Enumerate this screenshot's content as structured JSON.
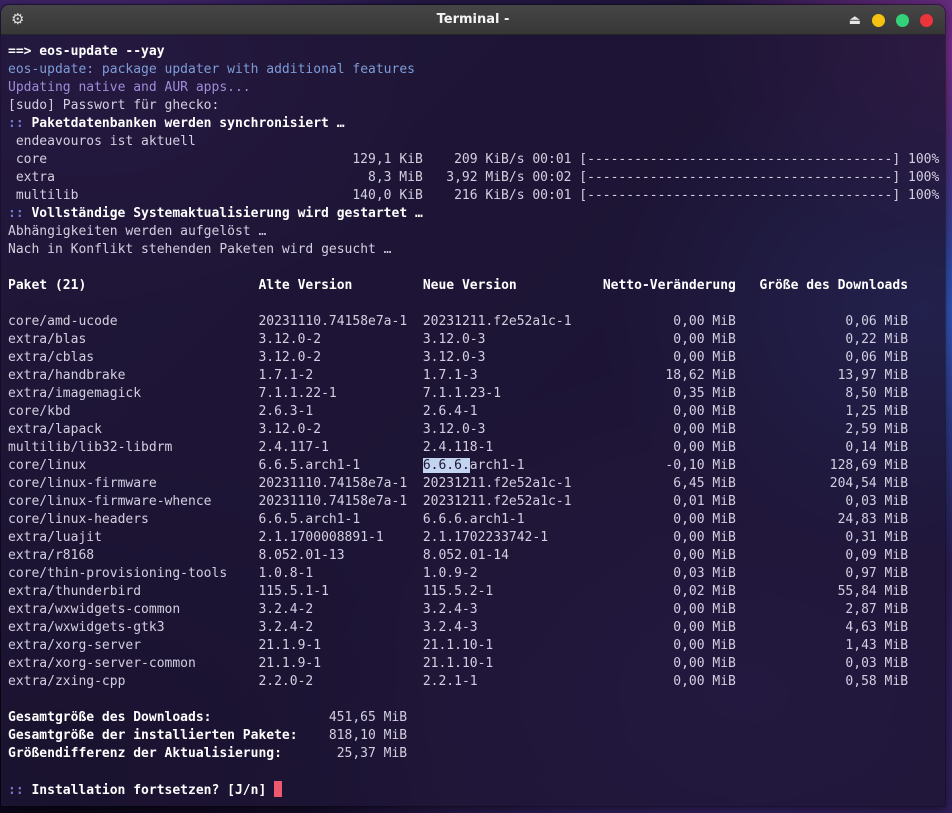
{
  "window": {
    "title": "Terminal -"
  },
  "icons": {
    "app_gear": "⚙",
    "shade": "⏏"
  },
  "colors": {
    "terminal_bg": "#1e1534",
    "default_text": "#d3cfe1",
    "bold_text": "#ffffff",
    "info_blue": "#7e9cd8",
    "info_purple": "#9e8cd8",
    "marker_blue": "#7678d4",
    "cursor_pink": "#ef5970",
    "highlight_bg": "#c3d4f0",
    "titlebar_bg": "#3b3b3b",
    "btn_yellow": "#f5c211",
    "btn_green": "#33d17a",
    "btn_red": "#ed333b"
  },
  "terminal": {
    "cmd_line": "==> eos-update --yay",
    "eos_info": "eos-update: package updater with additional features",
    "updating_line": "Updating native and AUR apps...",
    "sudo_line": "[sudo] Passwort für ghecko:",
    "marker": "::",
    "sync_msg": "Paketdatenbanken werden synchronisiert …",
    "uptodate_line": " endeavouros ist aktuell",
    "downloads": [
      {
        "name": " core",
        "size": "129,1 KiB",
        "speed": "209 KiB/s",
        "time": "00:01",
        "bar": "[---------------------------------------]",
        "pct": "100%"
      },
      {
        "name": " extra",
        "size": "8,3 MiB",
        "speed": "3,92 MiB/s",
        "time": "00:02",
        "bar": "[---------------------------------------]",
        "pct": "100%"
      },
      {
        "name": " multilib",
        "size": "140,0 KiB",
        "speed": "216 KiB/s",
        "time": "00:01",
        "bar": "[---------------------------------------]",
        "pct": "100%"
      }
    ],
    "upgrade_msg": "Vollständige Systemaktualisierung wird gestartet …",
    "resolve_line": "Abhängigkeiten werden aufgelöst …",
    "conflict_line": "Nach in Konflikt stehenden Paketen wird gesucht …",
    "table": {
      "headers": {
        "paket": "Paket (21)",
        "alt": "Alte Version",
        "neu": "Neue Version",
        "netto": "Netto-Veränderung",
        "groesse": "Größe des Downloads"
      },
      "rows": [
        {
          "paket": "core/amd-ucode",
          "alt": "20231110.74158e7a-1",
          "neu_hl": "",
          "neu": "20231211.f2e52a1c-1",
          "netto": "0,00 MiB",
          "groesse": "0,06 MiB"
        },
        {
          "paket": "extra/blas",
          "alt": "3.12.0-2",
          "neu_hl": "",
          "neu": "3.12.0-3",
          "netto": "0,00 MiB",
          "groesse": "0,22 MiB"
        },
        {
          "paket": "extra/cblas",
          "alt": "3.12.0-2",
          "neu_hl": "",
          "neu": "3.12.0-3",
          "netto": "0,00 MiB",
          "groesse": "0,06 MiB"
        },
        {
          "paket": "extra/handbrake",
          "alt": "1.7.1-2",
          "neu_hl": "",
          "neu": "1.7.1-3",
          "netto": "18,62 MiB",
          "groesse": "13,97 MiB"
        },
        {
          "paket": "extra/imagemagick",
          "alt": "7.1.1.22-1",
          "neu_hl": "",
          "neu": "7.1.1.23-1",
          "netto": "0,35 MiB",
          "groesse": "8,50 MiB"
        },
        {
          "paket": "core/kbd",
          "alt": "2.6.3-1",
          "neu_hl": "",
          "neu": "2.6.4-1",
          "netto": "0,00 MiB",
          "groesse": "1,25 MiB"
        },
        {
          "paket": "extra/lapack",
          "alt": "3.12.0-2",
          "neu_hl": "",
          "neu": "3.12.0-3",
          "netto": "0,00 MiB",
          "groesse": "2,59 MiB"
        },
        {
          "paket": "multilib/lib32-libdrm",
          "alt": "2.4.117-1",
          "neu_hl": "",
          "neu": "2.4.118-1",
          "netto": "0,00 MiB",
          "groesse": "0,14 MiB"
        },
        {
          "paket": "core/linux",
          "alt": "6.6.5.arch1-1",
          "neu_hl": "6.6.6.",
          "neu": "arch1-1",
          "netto": "-0,10 MiB",
          "groesse": "128,69 MiB"
        },
        {
          "paket": "core/linux-firmware",
          "alt": "20231110.74158e7a-1",
          "neu_hl": "",
          "neu": "20231211.f2e52a1c-1",
          "netto": "6,45 MiB",
          "groesse": "204,54 MiB"
        },
        {
          "paket": "core/linux-firmware-whence",
          "alt": "20231110.74158e7a-1",
          "neu_hl": "",
          "neu": "20231211.f2e52a1c-1",
          "netto": "0,01 MiB",
          "groesse": "0,03 MiB"
        },
        {
          "paket": "core/linux-headers",
          "alt": "6.6.5.arch1-1",
          "neu_hl": "",
          "neu": "6.6.6.arch1-1",
          "netto": "0,00 MiB",
          "groesse": "24,83 MiB"
        },
        {
          "paket": "extra/luajit",
          "alt": "2.1.1700008891-1",
          "neu_hl": "",
          "neu": "2.1.1702233742-1",
          "netto": "0,00 MiB",
          "groesse": "0,31 MiB"
        },
        {
          "paket": "extra/r8168",
          "alt": "8.052.01-13",
          "neu_hl": "",
          "neu": "8.052.01-14",
          "netto": "0,00 MiB",
          "groesse": "0,09 MiB"
        },
        {
          "paket": "core/thin-provisioning-tools",
          "alt": "1.0.8-1",
          "neu_hl": "",
          "neu": "1.0.9-2",
          "netto": "0,03 MiB",
          "groesse": "0,97 MiB"
        },
        {
          "paket": "extra/thunderbird",
          "alt": "115.5.1-1",
          "neu_hl": "",
          "neu": "115.5.2-1",
          "netto": "0,02 MiB",
          "groesse": "55,84 MiB"
        },
        {
          "paket": "extra/wxwidgets-common",
          "alt": "3.2.4-2",
          "neu_hl": "",
          "neu": "3.2.4-3",
          "netto": "0,00 MiB",
          "groesse": "2,87 MiB"
        },
        {
          "paket": "extra/wxwidgets-gtk3",
          "alt": "3.2.4-2",
          "neu_hl": "",
          "neu": "3.2.4-3",
          "netto": "0,00 MiB",
          "groesse": "4,63 MiB"
        },
        {
          "paket": "extra/xorg-server",
          "alt": "21.1.9-1",
          "neu_hl": "",
          "neu": "21.1.10-1",
          "netto": "0,00 MiB",
          "groesse": "1,43 MiB"
        },
        {
          "paket": "extra/xorg-server-common",
          "alt": "21.1.9-1",
          "neu_hl": "",
          "neu": "21.1.10-1",
          "netto": "0,00 MiB",
          "groesse": "0,03 MiB"
        },
        {
          "paket": "extra/zxing-cpp",
          "alt": "2.2.0-2",
          "neu_hl": "",
          "neu": "2.2.1-1",
          "netto": "0,00 MiB",
          "groesse": "0,58 MiB"
        }
      ]
    },
    "summary": [
      {
        "label": "Gesamtgröße des Downloads:",
        "value": "451,65 MiB"
      },
      {
        "label": "Gesamtgröße der installierten Pakete:",
        "value": "818,10 MiB"
      },
      {
        "label": "Größendifferenz der Aktualisierung:",
        "value": "25,37 MiB"
      }
    ],
    "question": "Installation fortsetzen? [J/n]"
  }
}
